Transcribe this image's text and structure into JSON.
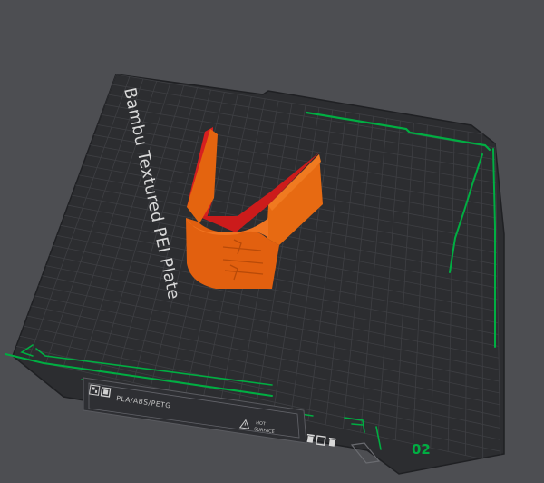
{
  "viewport": {
    "plate_name": "Bambu Textured PEI Plate",
    "filament_label": "PLA/ABS/PETG",
    "hot_surface_line1": "HOT",
    "hot_surface_line2": "SURFACE",
    "plate_number": "02",
    "icons": [
      "qr-code-icon",
      "warning-icon",
      "trash-icon",
      "square-icon"
    ]
  },
  "colors": {
    "background": "#4d4e52",
    "plate": "#2c2d30",
    "grid": "#3e3f43",
    "accent_green": "#00ae42",
    "model_orange": "#e8620f",
    "model_red": "#e01b1b"
  }
}
